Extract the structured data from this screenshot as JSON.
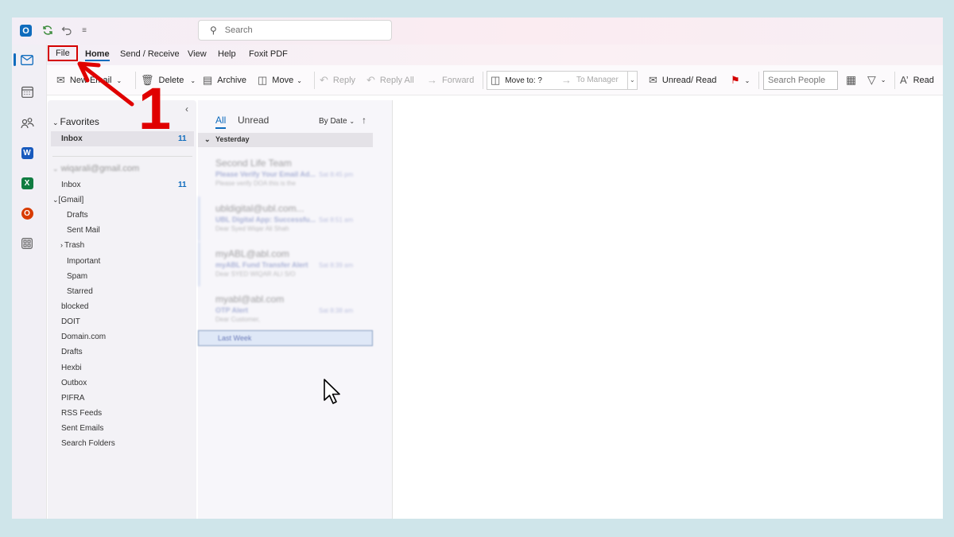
{
  "titlebar": {
    "search_placeholder": "Search"
  },
  "ribbon_tabs": [
    "File",
    "Home",
    "Send / Receive",
    "View",
    "Help",
    "Foxit PDF"
  ],
  "toolbar": {
    "new_email": "New Email",
    "delete": "Delete",
    "archive": "Archive",
    "move": "Move",
    "reply": "Reply",
    "reply_all": "Reply All",
    "forward": "Forward",
    "move_to": "Move to: ?",
    "to_manager": "To Manager",
    "unread_read": "Unread/ Read",
    "search_people": "Search People",
    "read": "Read"
  },
  "folders": {
    "favorites_label": "Favorites",
    "favorites_inbox": "Inbox",
    "favorites_inbox_count": "11",
    "account": "wiqarali@gmail.com",
    "inbox": "Inbox",
    "inbox_count": "11",
    "gmail": "[Gmail]",
    "gmail_children": [
      "Drafts",
      "Sent Mail",
      "Trash",
      "Important",
      "Spam",
      "Starred"
    ],
    "others": [
      "blocked",
      "DOIT",
      "Domain.com",
      "Drafts",
      "Hexbi",
      "Outbox",
      "PIFRA",
      "RSS Feeds",
      "Sent Emails",
      "Search Folders"
    ]
  },
  "message_list": {
    "tab_all": "All",
    "tab_unread": "Unread",
    "sort_label": "By Date",
    "group_yesterday": "Yesterday",
    "messages": [
      {
        "sender": "Second Life Team",
        "subject": "Please Verify Your Email Ad...",
        "preview": "Please verify DOA this is the",
        "time": "Sat 8:45 pm"
      },
      {
        "sender": "ubldigital@ubl.com...",
        "subject": "UBL Digital App: Successfu...",
        "preview": "Dear Syed Wiqar Ali Shah",
        "time": "Sat 8:51 am"
      },
      {
        "sender": "myABL@abl.com",
        "subject": "myABL Fund Transfer Alert",
        "preview": "Dear SYED WIQAR ALI S/O",
        "time": "Sat 8:39 am"
      },
      {
        "sender": "myabl@abl.com",
        "subject": "OTP Alert",
        "preview": "Dear Customer,",
        "time": "Sat 8:38 am"
      }
    ],
    "group_last_week": "Last Week"
  },
  "annotation": {
    "step_number": "1",
    "color": "#e00000"
  },
  "colors": {
    "accent": "#0f6cbd",
    "highlight": "#d40000"
  }
}
